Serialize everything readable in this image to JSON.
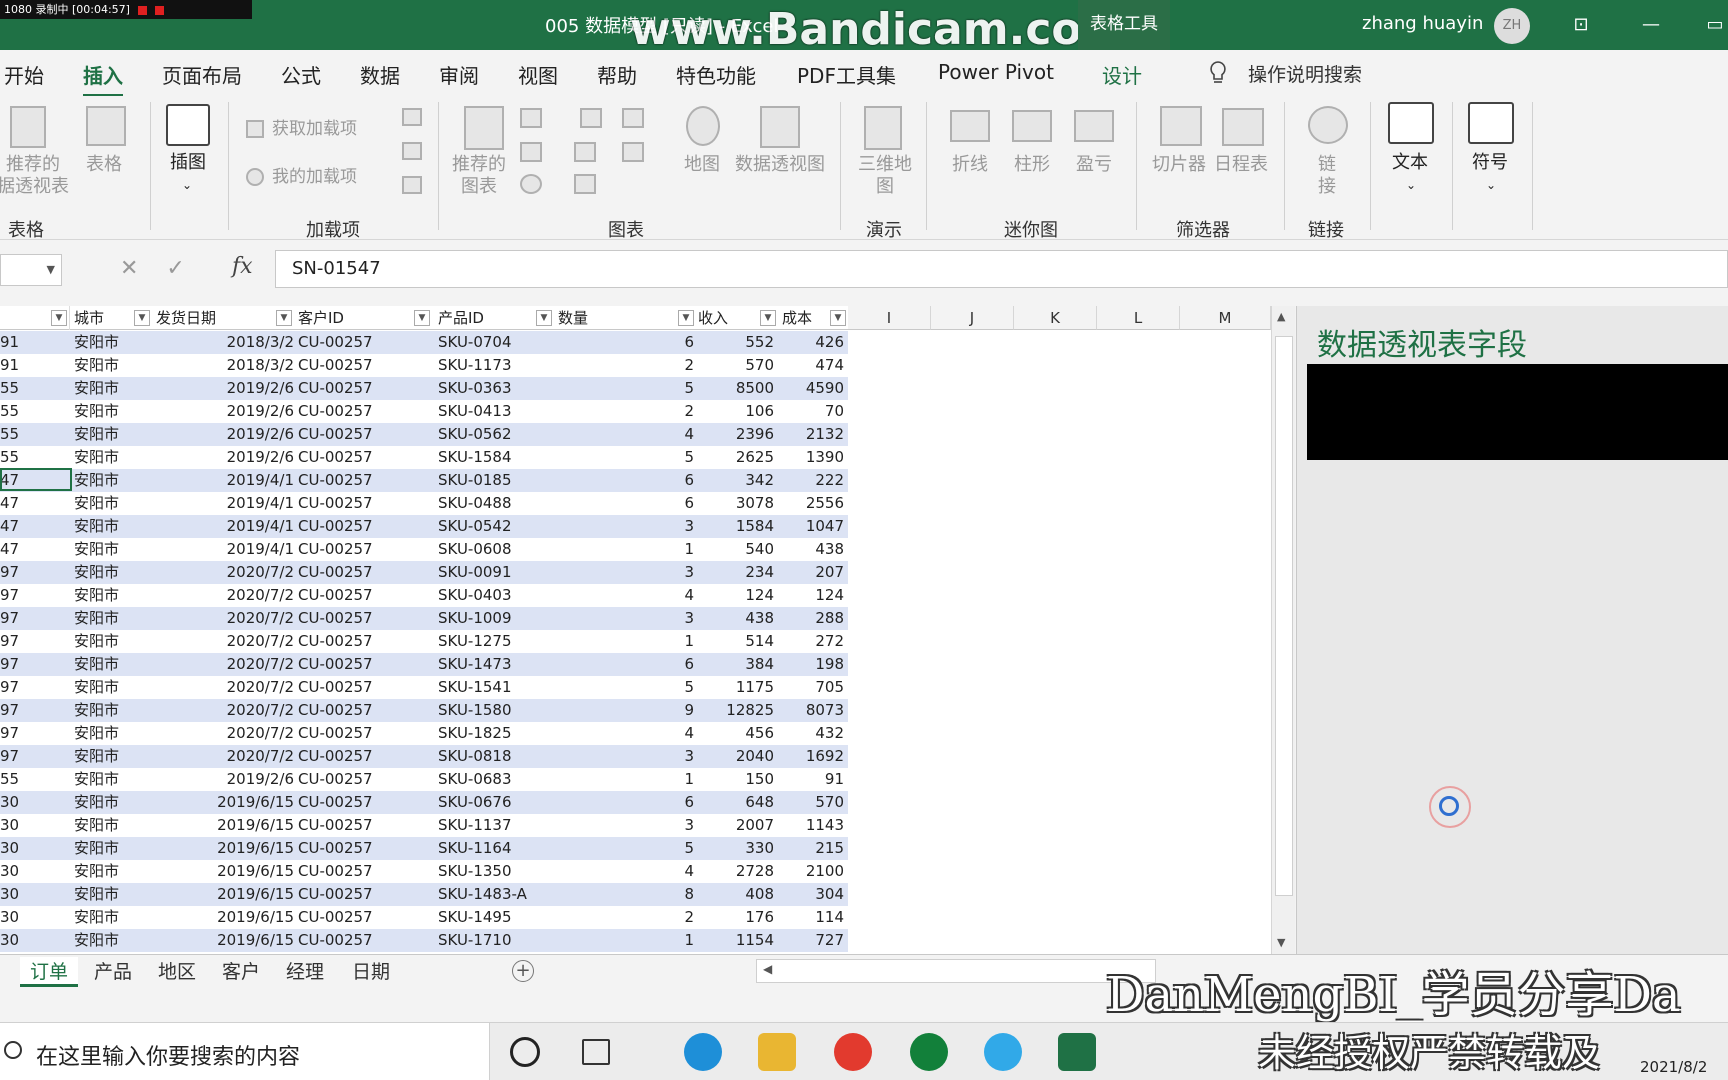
{
  "recorder": {
    "text": "1080  录制中 [00:04:57]"
  },
  "titlebar": {
    "doc_title": "005 数据模型 [只读] - Excel",
    "watermark": "www.Bandicam.com",
    "context_tab": "表格工具",
    "user_name": "zhang huayin",
    "avatar": "ZH"
  },
  "tabs": [
    "开始",
    "插入",
    "页面布局",
    "公式",
    "数据",
    "审阅",
    "视图",
    "帮助",
    "特色功能",
    "PDF工具集",
    "Power Pivot",
    "设计"
  ],
  "tell_me": "操作说明搜索",
  "ribbon": {
    "recommended_pivot": "推荐的\n据透视表",
    "table": "表格",
    "illustrations": "插图",
    "get_addins": "获取加载项",
    "my_addins": "我的加载项",
    "recommended_charts": "推荐的\n图表",
    "map": "地图",
    "pivot_chart": "数据透视图",
    "map3d": "三维地\n图",
    "line": "折线",
    "column": "柱形",
    "winloss": "盈亏",
    "slicer": "切片器",
    "timeline": "日程表",
    "link": "链\n接",
    "text": "文本",
    "symbol": "符号",
    "groups": {
      "tables": "表格",
      "addins": "加载项",
      "charts": "图表",
      "tours": "演示",
      "sparklines": "迷你图",
      "filters": "筛选器",
      "links": "链接"
    }
  },
  "formula": {
    "value": "SN-01547"
  },
  "columns": {
    "headers": [
      "城市",
      "发货日期",
      "客户ID",
      "产品ID",
      "数量",
      "收入",
      "成本"
    ],
    "letters": [
      "I",
      "J",
      "K",
      "L",
      "M"
    ]
  },
  "rows": [
    [
      "91",
      "安阳市",
      "2018/3/2",
      "CU-00257",
      "SKU-0704",
      "6",
      "552",
      "426"
    ],
    [
      "91",
      "安阳市",
      "2018/3/2",
      "CU-00257",
      "SKU-1173",
      "2",
      "570",
      "474"
    ],
    [
      "55",
      "安阳市",
      "2019/2/6",
      "CU-00257",
      "SKU-0363",
      "5",
      "8500",
      "4590"
    ],
    [
      "55",
      "安阳市",
      "2019/2/6",
      "CU-00257",
      "SKU-0413",
      "2",
      "106",
      "70"
    ],
    [
      "55",
      "安阳市",
      "2019/2/6",
      "CU-00257",
      "SKU-0562",
      "4",
      "2396",
      "2132"
    ],
    [
      "55",
      "安阳市",
      "2019/2/6",
      "CU-00257",
      "SKU-1584",
      "5",
      "2625",
      "1390"
    ],
    [
      "47",
      "安阳市",
      "2019/4/1",
      "CU-00257",
      "SKU-0185",
      "6",
      "342",
      "222"
    ],
    [
      "47",
      "安阳市",
      "2019/4/1",
      "CU-00257",
      "SKU-0488",
      "6",
      "3078",
      "2556"
    ],
    [
      "47",
      "安阳市",
      "2019/4/1",
      "CU-00257",
      "SKU-0542",
      "3",
      "1584",
      "1047"
    ],
    [
      "47",
      "安阳市",
      "2019/4/1",
      "CU-00257",
      "SKU-0608",
      "1",
      "540",
      "438"
    ],
    [
      "97",
      "安阳市",
      "2020/7/2",
      "CU-00257",
      "SKU-0091",
      "3",
      "234",
      "207"
    ],
    [
      "97",
      "安阳市",
      "2020/7/2",
      "CU-00257",
      "SKU-0403",
      "4",
      "124",
      "124"
    ],
    [
      "97",
      "安阳市",
      "2020/7/2",
      "CU-00257",
      "SKU-1009",
      "3",
      "438",
      "288"
    ],
    [
      "97",
      "安阳市",
      "2020/7/2",
      "CU-00257",
      "SKU-1275",
      "1",
      "514",
      "272"
    ],
    [
      "97",
      "安阳市",
      "2020/7/2",
      "CU-00257",
      "SKU-1473",
      "6",
      "384",
      "198"
    ],
    [
      "97",
      "安阳市",
      "2020/7/2",
      "CU-00257",
      "SKU-1541",
      "5",
      "1175",
      "705"
    ],
    [
      "97",
      "安阳市",
      "2020/7/2",
      "CU-00257",
      "SKU-1580",
      "9",
      "12825",
      "8073"
    ],
    [
      "97",
      "安阳市",
      "2020/7/2",
      "CU-00257",
      "SKU-1825",
      "4",
      "456",
      "432"
    ],
    [
      "97",
      "安阳市",
      "2020/7/2",
      "CU-00257",
      "SKU-0818",
      "3",
      "2040",
      "1692"
    ],
    [
      "55",
      "安阳市",
      "2019/2/6",
      "CU-00257",
      "SKU-0683",
      "1",
      "150",
      "91"
    ],
    [
      "30",
      "安阳市",
      "2019/6/15",
      "CU-00257",
      "SKU-0676",
      "6",
      "648",
      "570"
    ],
    [
      "30",
      "安阳市",
      "2019/6/15",
      "CU-00257",
      "SKU-1137",
      "3",
      "2007",
      "1143"
    ],
    [
      "30",
      "安阳市",
      "2019/6/15",
      "CU-00257",
      "SKU-1164",
      "5",
      "330",
      "215"
    ],
    [
      "30",
      "安阳市",
      "2019/6/15",
      "CU-00257",
      "SKU-1350",
      "4",
      "2728",
      "2100"
    ],
    [
      "30",
      "安阳市",
      "2019/6/15",
      "CU-00257",
      "SKU-1483-A",
      "8",
      "408",
      "304"
    ],
    [
      "30",
      "安阳市",
      "2019/6/15",
      "CU-00257",
      "SKU-1495",
      "2",
      "176",
      "114"
    ],
    [
      "30",
      "安阳市",
      "2019/6/15",
      "CU-00257",
      "SKU-1710",
      "1",
      "1154",
      "727"
    ]
  ],
  "pane": {
    "title": "数据透视表字段"
  },
  "sheet_tabs": [
    "订单",
    "产品",
    "地区",
    "客户",
    "经理",
    "日期"
  ],
  "watermark2": "DanMengBI_学员分享Da",
  "watermark3": "未经授权严禁转载及",
  "taskbar": {
    "search": "在这里输入你要搜索的内容",
    "clock": "2021/8/2"
  },
  "colors": {
    "excel_green": "#1f7145",
    "band": "#dce3f4"
  }
}
